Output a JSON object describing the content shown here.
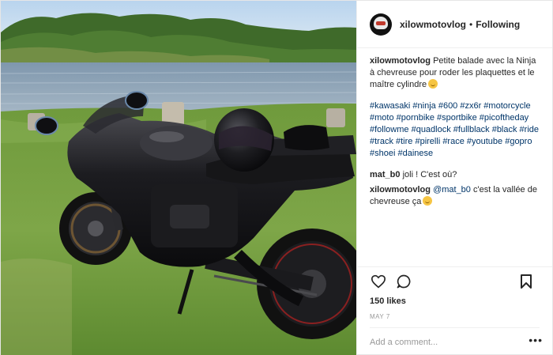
{
  "header": {
    "username": "xilowmotovlog",
    "separator": "•",
    "follow_label": "Following",
    "avatar_icon": "helmet-avatar-icon"
  },
  "caption": {
    "username": "xilowmotovlog",
    "text": "Petite balade avec la Ninja à chevreuse pour roder les plaquettes et le maître cylindre",
    "emoji": "wink-emoji"
  },
  "hashtags": {
    "username": "",
    "text": "#kawasaki #ninja #600 #zx6r #motorcycle #moto #pornbike #sportbike #picoftheday #followme #quadlock #fullblack #black #ride #track #tire #pirelli #race #youtube #gopro #shoei #dainese"
  },
  "comments": [
    {
      "username": "mat_b0",
      "text": "joli ! C'est où?"
    },
    {
      "username": "xilowmotovlog",
      "mention": "@mat_b0",
      "text": "c'est la vallée de chevreuse ça"
    }
  ],
  "actions": {
    "like_icon": "heart-icon",
    "comment_icon": "comment-icon",
    "bookmark_icon": "bookmark-icon"
  },
  "likes": "150 likes",
  "date": "MAY 7",
  "add_comment": {
    "placeholder": "Add a comment...",
    "more_label": "•••"
  },
  "colors": {
    "link": "#003569",
    "text": "#262626",
    "muted": "#999999",
    "border": "#efefef"
  }
}
